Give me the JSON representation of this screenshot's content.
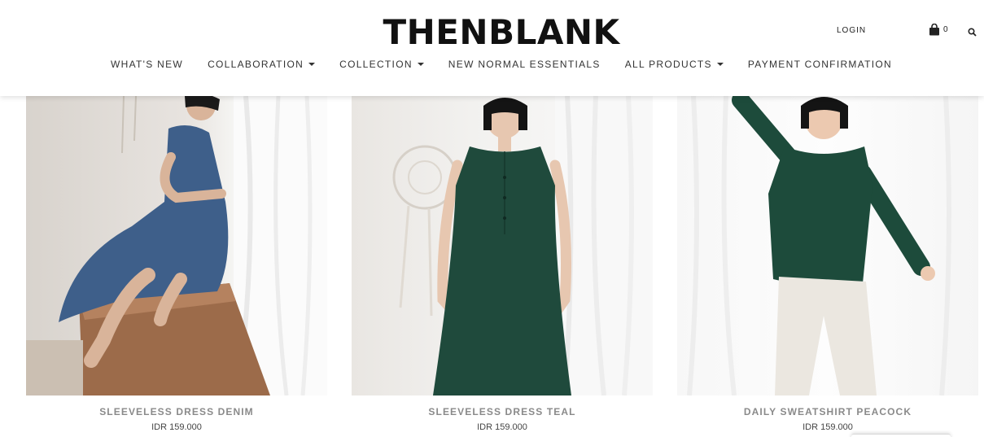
{
  "header": {
    "logo": "THENBLANK",
    "login_label": "LOGIN",
    "cart_count": "0",
    "cart_icon": "shopping-bag-icon",
    "search_icon": "search-icon"
  },
  "nav": {
    "items": [
      {
        "label": "WHAT'S NEW",
        "dropdown": false
      },
      {
        "label": "COLLABORATION",
        "dropdown": true
      },
      {
        "label": "COLLECTION",
        "dropdown": true
      },
      {
        "label": "NEW NORMAL ESSENTIALS",
        "dropdown": false
      },
      {
        "label": "ALL PRODUCTS",
        "dropdown": true
      },
      {
        "label": "PAYMENT CONFIRMATION",
        "dropdown": false
      }
    ]
  },
  "products": [
    {
      "name": "SLEEVELESS DRESS DENIM",
      "price": "IDR 159.000",
      "garment_color": "#3e5f8a"
    },
    {
      "name": "SLEEVELESS DRESS TEAL",
      "price": "IDR 159.000",
      "garment_color": "#1f4a3c"
    },
    {
      "name": "DAILY SWEATSHIRT PEACOCK",
      "price": "IDR 159.000",
      "garment_color": "#1d4b3b"
    }
  ]
}
